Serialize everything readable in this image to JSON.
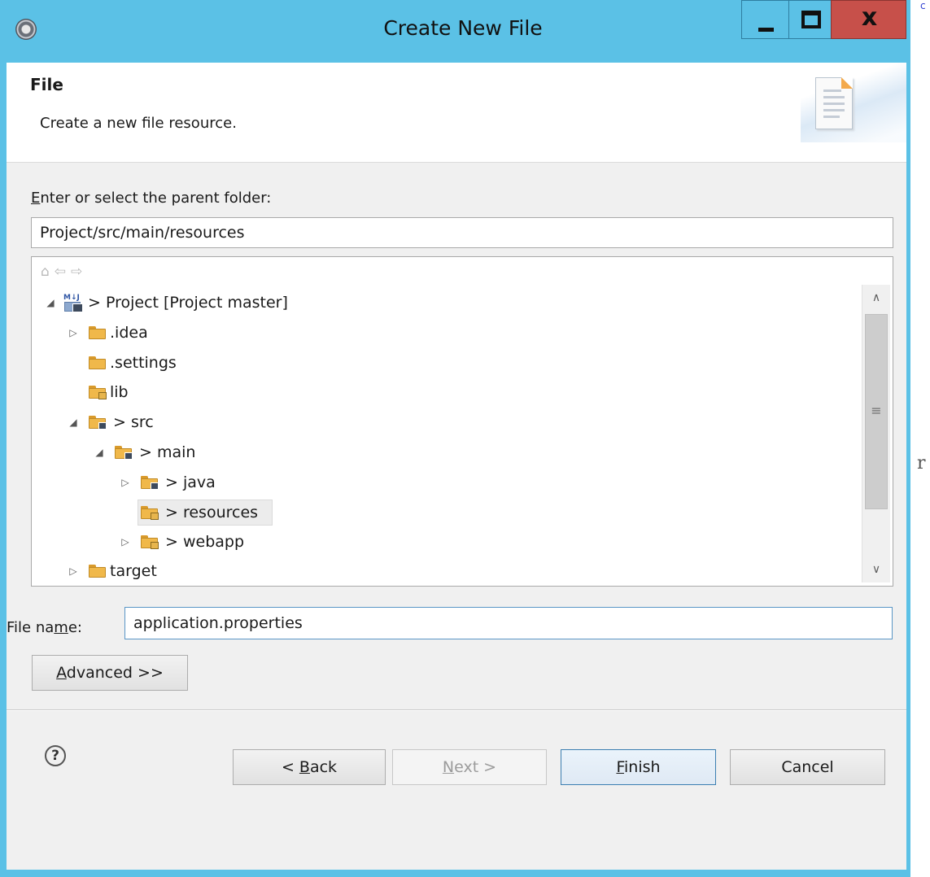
{
  "window": {
    "title": "Create New File",
    "controls": {
      "close_glyph": "x"
    }
  },
  "header": {
    "title": "File",
    "description": "Create a new file resource."
  },
  "parent_folder": {
    "label_prefix": "E",
    "label_rest": "nter or select the parent folder:",
    "value": "Project/src/main/resources"
  },
  "nav_icons": [
    "home-icon",
    "back-arrow-icon",
    "forward-arrow-icon"
  ],
  "tree": {
    "project": "> Project [Project master]",
    "idea": ".idea",
    "settings": ".settings",
    "lib": "lib",
    "src": "> src",
    "main": "> main",
    "java": "> java",
    "resources": "> resources",
    "webapp": "> webapp",
    "target": "target"
  },
  "file_name": {
    "label_a": "File na",
    "label_u": "m",
    "label_b": "e:",
    "value": "application.properties"
  },
  "advanced_button": {
    "u": "A",
    "rest": "dvanced >>"
  },
  "buttons": {
    "back_a": "< ",
    "back_u": "B",
    "back_b": "ack",
    "next_u": "N",
    "next_b": "ext >",
    "finish_u": "F",
    "finish_b": "inish",
    "cancel": "Cancel"
  },
  "outside": {
    "right_char": "r",
    "top_char": "c"
  },
  "colors": {
    "title_bar": "#5bc1e6",
    "close_button": "#c7504a",
    "dialog_bg": "#f0f0f0",
    "folder": "#f0b84a"
  }
}
